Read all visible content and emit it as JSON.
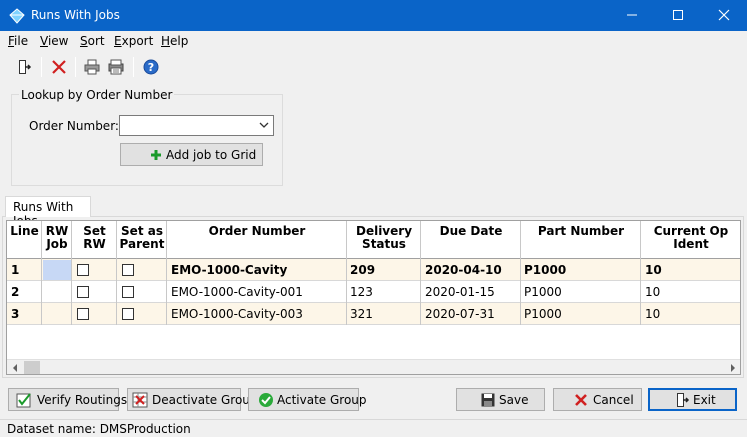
{
  "window": {
    "title": "Runs With Jobs"
  },
  "menu": [
    {
      "key": "F",
      "rest": "ile"
    },
    {
      "key": "V",
      "rest": "iew"
    },
    {
      "key": "S",
      "rest": "ort"
    },
    {
      "key": "E",
      "rest": "xport"
    },
    {
      "key": "H",
      "rest": "elp"
    }
  ],
  "toolbar_icons": [
    "exit-door-icon",
    "delete-x-icon",
    "print-icon",
    "print-preview-icon",
    "help-icon"
  ],
  "lookup": {
    "group_title": "Lookup by Order Number",
    "order_label": "Order Number:",
    "order_value": "",
    "add_button": "Add job to Grid"
  },
  "tab": {
    "label": "Runs With Jobs"
  },
  "grid": {
    "headers": [
      "Line",
      "RW Job",
      "Set RW",
      "Set as Parent",
      "Order Number",
      "Delivery Status",
      "Due Date",
      "Part Number",
      "Current Op Ident"
    ],
    "rows": [
      {
        "line": "1",
        "rw_job": "",
        "set_rw": false,
        "set_parent": false,
        "order": "EMO-1000-Cavity",
        "delivery": "209",
        "due": "2020-04-10",
        "part": "P1000",
        "op": "10"
      },
      {
        "line": "2",
        "rw_job": "",
        "set_rw": false,
        "set_parent": false,
        "order": "EMO-1000-Cavity-001",
        "delivery": "123",
        "due": "2020-01-15",
        "part": "P1000",
        "op": "10"
      },
      {
        "line": "3",
        "rw_job": "",
        "set_rw": false,
        "set_parent": false,
        "order": "EMO-1000-Cavity-003",
        "delivery": "321",
        "due": "2020-07-31",
        "part": "P1000",
        "op": "10"
      }
    ]
  },
  "buttons": {
    "verify": "Verify Routings",
    "deactivate": "Deactivate Group",
    "activate": "Activate Group",
    "save": "Save",
    "cancel": "Cancel",
    "exit": "Exit"
  },
  "status": {
    "text": "Dataset name:  DMSProduction"
  },
  "colors": {
    "titlebar": "#0a64c8",
    "row_highlight": "#fdf6e8",
    "selected_cell": "#c7d8f5"
  }
}
